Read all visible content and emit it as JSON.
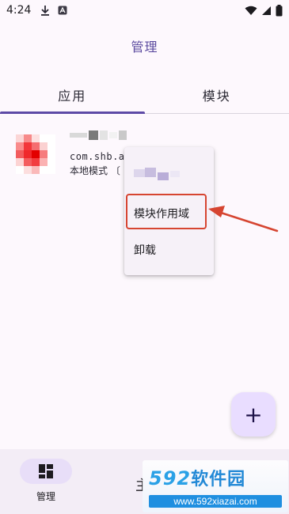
{
  "status_bar": {
    "time": "4:24",
    "icons": [
      "download-icon",
      "app-notification-icon",
      "wifi-icon",
      "signal-icon",
      "battery-icon"
    ]
  },
  "header": {
    "title": "管理"
  },
  "tabs": [
    {
      "label": "应用",
      "active": true
    },
    {
      "label": "模块",
      "active": false
    }
  ],
  "app_item": {
    "package": "com.shb.a",
    "mode": "本地模式 〔"
  },
  "popup_menu": {
    "items": [
      {
        "label": "模块作用域",
        "highlighted": true
      },
      {
        "label": "卸载",
        "highlighted": false
      }
    ]
  },
  "fab": {
    "symbol": "+"
  },
  "bottom_nav": {
    "items": [
      {
        "label": "管理",
        "active": true
      },
      {
        "label": "主页",
        "active": false
      }
    ]
  },
  "watermark": {
    "number": "592",
    "brand": "软件园",
    "url": "www.592xiazai.com"
  },
  "colors": {
    "accent": "#5d4aa6",
    "annotation": "#d64531",
    "fab_background": "#e9ddff"
  }
}
